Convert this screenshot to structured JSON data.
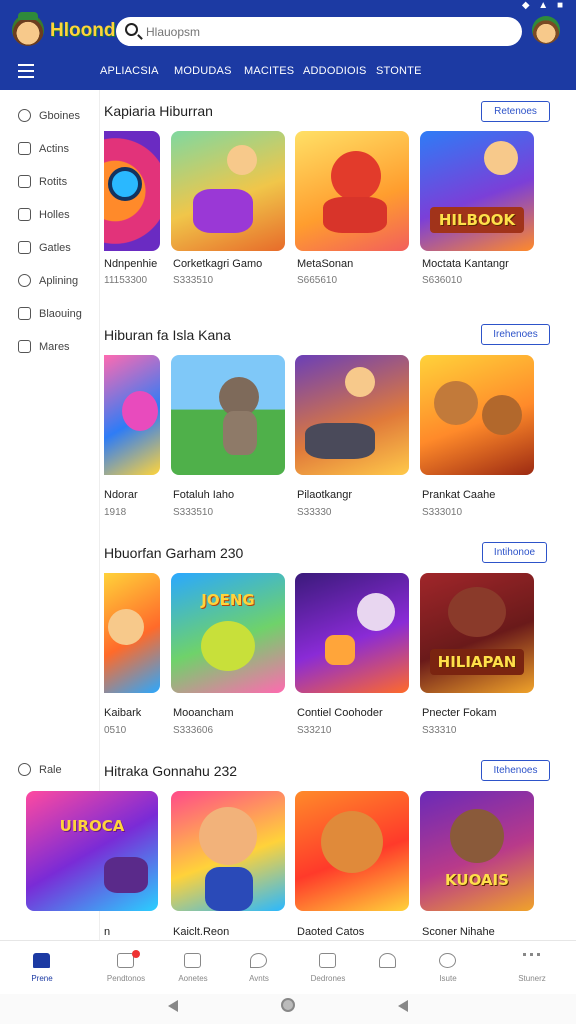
{
  "app": {
    "logo_text": "Hloonde",
    "search_placeholder": "Hlauopsm"
  },
  "nav": {
    "tabs": [
      "APLIACSIA",
      "MODUDAS",
      "MACITES",
      "ADDODIOIS",
      "STONTE"
    ]
  },
  "sidebar": {
    "items": [
      {
        "label": "Gboines",
        "icon": "search-icon"
      },
      {
        "label": "Actins",
        "icon": "chat-icon"
      },
      {
        "label": "Rotits",
        "icon": "bookmark-icon"
      },
      {
        "label": "Holles",
        "icon": "grid-icon"
      },
      {
        "label": "Gatles",
        "icon": "card-icon"
      },
      {
        "label": "Aplining",
        "icon": "smile-icon"
      },
      {
        "label": "Blaouing",
        "icon": "tag-icon"
      },
      {
        "label": "Mares",
        "icon": "settings-icon"
      },
      {
        "label": "Rale",
        "icon": "search-icon"
      }
    ]
  },
  "sections": [
    {
      "title": "Kapiaria Hiburran",
      "see_all": "Retenoes",
      "games": [
        {
          "name": "Ndnpenhie",
          "meta": "11153300"
        },
        {
          "name": "Corketkagri Gamo",
          "meta": "S333510"
        },
        {
          "name": "MetaSonan",
          "meta": "S665610"
        },
        {
          "name": "Moctata Kantangr",
          "meta": "S636010"
        }
      ]
    },
    {
      "title": "Hiburan fa Isla Kana",
      "see_all": "Irehenoes",
      "games": [
        {
          "name": "Ndorar",
          "meta": "1918"
        },
        {
          "name": "Fotaluh Iaho",
          "meta": "S333510"
        },
        {
          "name": "Pilaotkangr",
          "meta": "S33330"
        },
        {
          "name": "Prankat Caahe",
          "meta": "S333010"
        }
      ]
    },
    {
      "title": "Hbuorfan Garham 230",
      "see_all": "Intihonoe",
      "games": [
        {
          "name": "Kaibark",
          "meta": "0510"
        },
        {
          "name": "Mooancham",
          "meta": "S333606"
        },
        {
          "name": "Contiel Coohoder",
          "meta": "S33210"
        },
        {
          "name": "Pnecter Fokam",
          "meta": "S33310"
        }
      ]
    },
    {
      "title": "Hitraka Gonnahu 232",
      "see_all": "Itehenoes",
      "games": [
        {
          "name": "n",
          "meta": ""
        },
        {
          "name": "Kaiclt.Reon",
          "meta": ""
        },
        {
          "name": "Daoted Catos",
          "meta": ""
        },
        {
          "name": "Sconer Nihahe",
          "meta": ""
        }
      ]
    }
  ],
  "banners": [
    "HILBOOK",
    "JOENG",
    "HILIAPAN",
    "UIROCA",
    "KUOAIS"
  ],
  "bottom_nav": [
    {
      "label": "Prene",
      "active": true
    },
    {
      "label": "Pendtonos",
      "active": false,
      "badge": true
    },
    {
      "label": "Aonetes",
      "active": false
    },
    {
      "label": "Avnts",
      "active": false
    },
    {
      "label": "Dedrones",
      "active": false
    },
    {
      "label": "",
      "active": false
    },
    {
      "label": "Isute",
      "active": false
    },
    {
      "label": "Stunerz",
      "active": false
    }
  ],
  "colors": {
    "primary": "#1c3aa3",
    "accent": "#2d53c9",
    "logo": "#ffd43b"
  }
}
